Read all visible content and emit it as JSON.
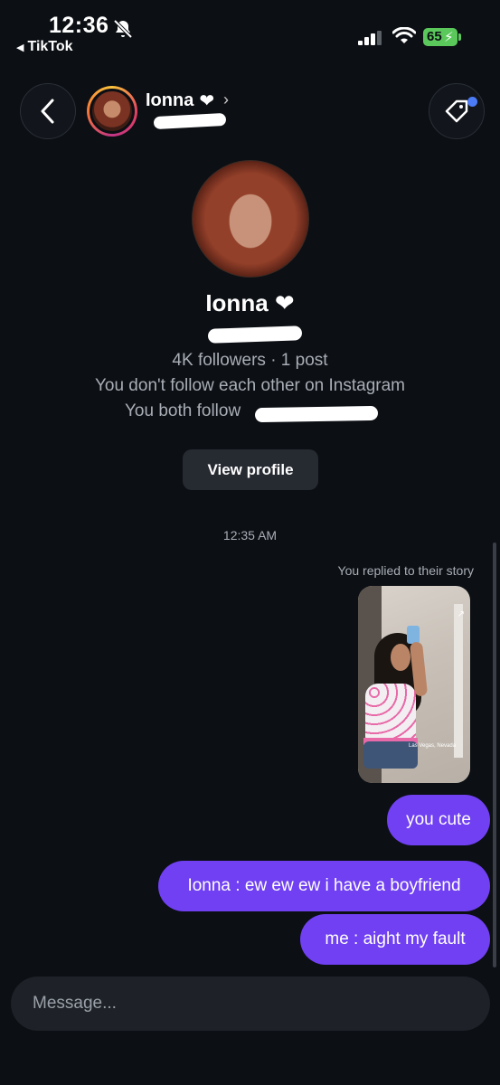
{
  "status_bar": {
    "time": "12:36",
    "back_app": "TikTok",
    "battery": "65"
  },
  "header": {
    "name": "Ionna",
    "heart": "❤",
    "chevron": "›"
  },
  "profile": {
    "name": "Ionna ❤",
    "stats": "4K followers · 1 post",
    "follow_note": "You don't follow each other on Instagram",
    "mutual_prefix": "You both follow",
    "view_profile_label": "View profile"
  },
  "chat": {
    "timestamp": "12:35 AM",
    "reply_note": "You replied to their story",
    "story_location": "Las Vegas, Nevada",
    "messages": [
      {
        "text": "you cute"
      },
      {
        "text": "Ionna : ew ew ew i have a boyfriend"
      },
      {
        "text": "me : aight my fault"
      }
    ]
  },
  "composer": {
    "placeholder": "Message..."
  },
  "colors": {
    "background": "#0c0f14",
    "bubble": "#7040f2",
    "button": "#262a31",
    "battery": "#5ac85a",
    "tag_dot": "#4c7bf7"
  }
}
